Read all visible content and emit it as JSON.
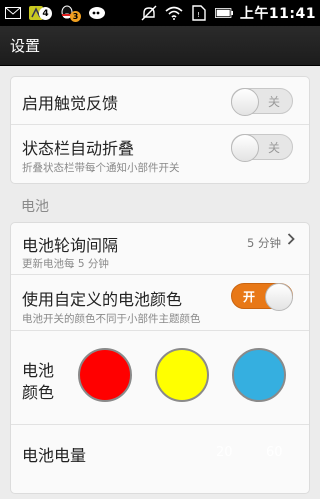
{
  "status_bar": {
    "notif_badge_1": "4",
    "notif_badge_2": "3",
    "time": "上午11:41"
  },
  "title": "设置",
  "general": {
    "haptic_label": "启用触觉反馈",
    "haptic_state": "关",
    "collapse_label": "状态栏自动折叠",
    "collapse_sub": "折叠状态栏带每个通知小部件开关",
    "collapse_state": "关"
  },
  "battery_section": "电池",
  "battery": {
    "poll_label": "电池轮询间隔",
    "poll_sub": "更新电池每 5 分钟",
    "poll_value": "5 分钟",
    "custom_color_label": "使用自定义的电池颜色",
    "custom_color_sub": "电池开关的颜色不同于小部件主题颜色",
    "custom_color_state": "开",
    "color_label_1": "电池",
    "color_label_2": "颜色",
    "colors": [
      "#ff0000",
      "#ffff00",
      "#35afe0"
    ],
    "level_label": "电池电量",
    "level_values": [
      "20",
      "60"
    ]
  },
  "icons": [
    "mail-icon",
    "app-notification-icon",
    "qq-icon",
    "chat-icon",
    "mute-icon",
    "wifi-icon",
    "sim-icon",
    "battery-icon",
    "chevron-right-icon"
  ]
}
